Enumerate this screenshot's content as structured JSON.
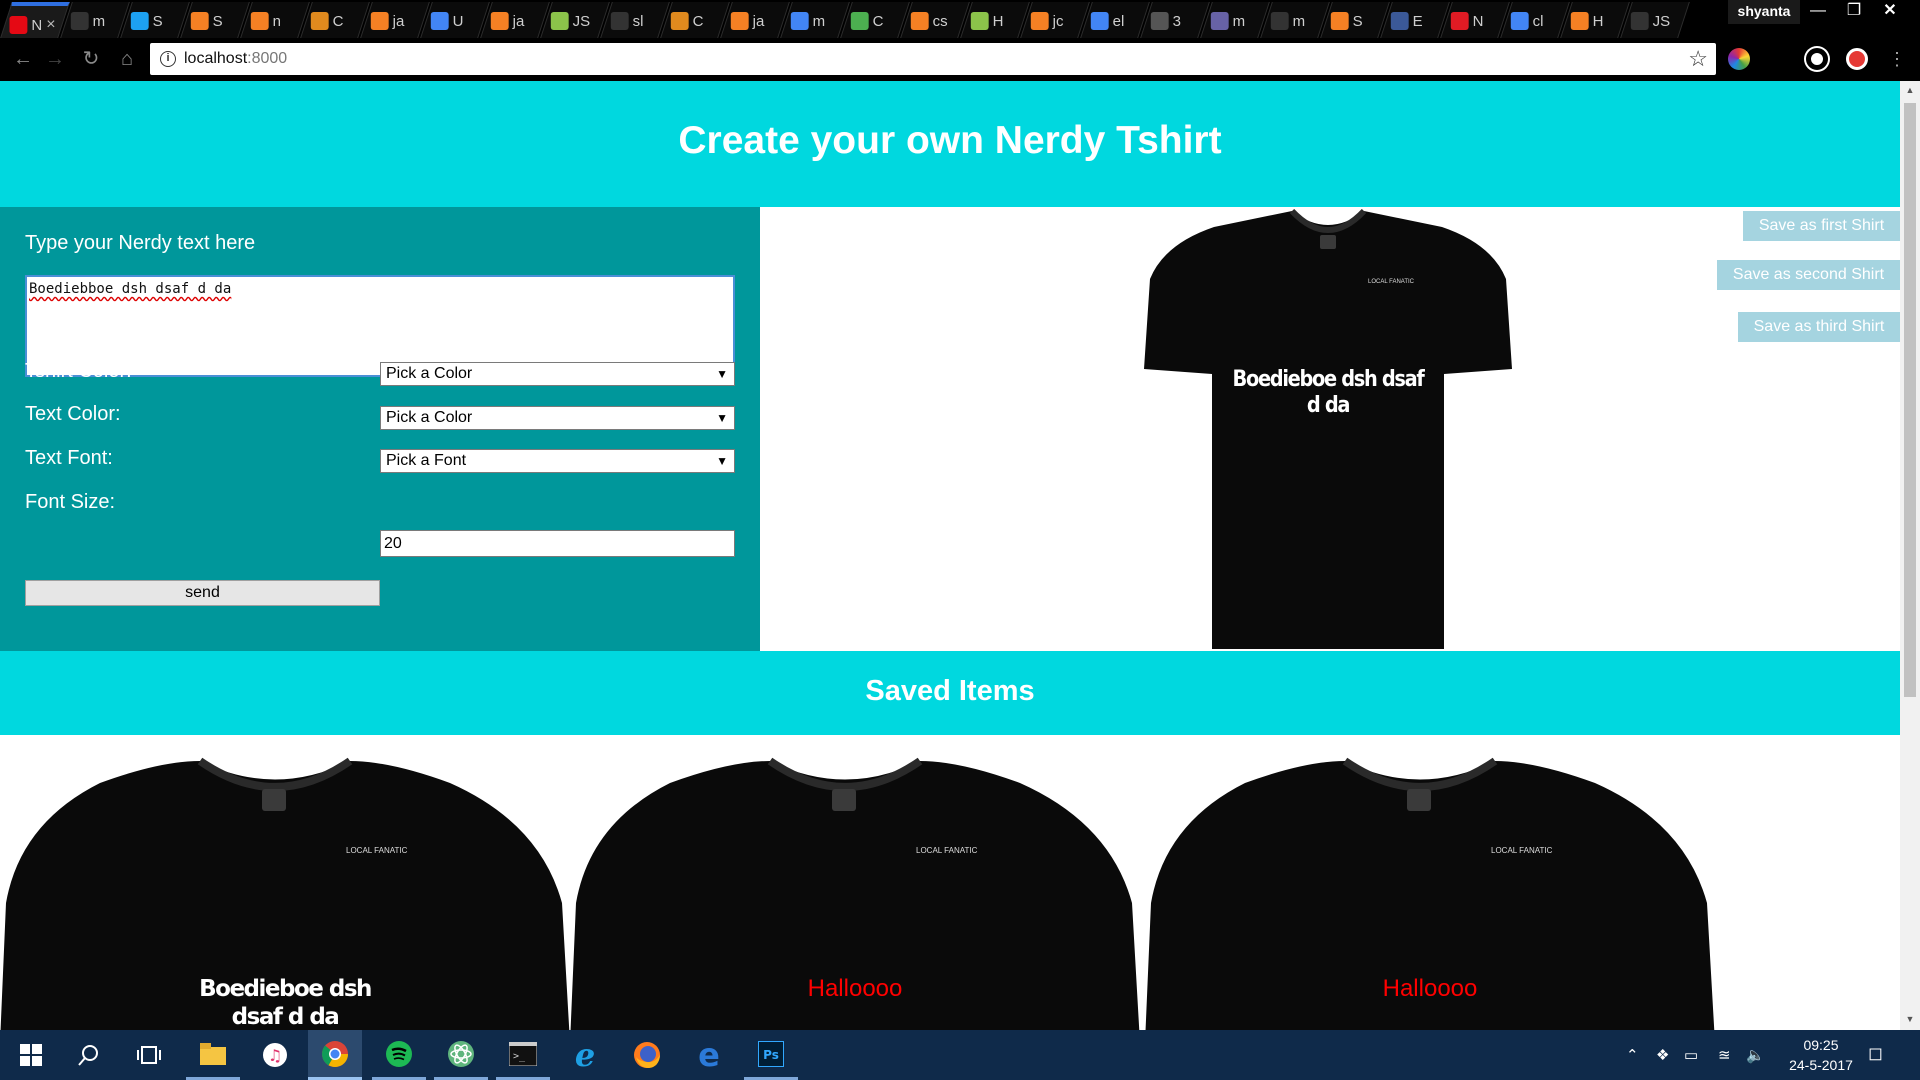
{
  "browser": {
    "tabs": [
      {
        "text": "N",
        "icon": "netflix-icon",
        "color": "#e50914",
        "active": true,
        "close": "×"
      },
      {
        "text": "m",
        "icon": "github-icon",
        "color": "#333333"
      },
      {
        "text": "S",
        "icon": "twitter-icon",
        "color": "#1da1f2"
      },
      {
        "text": "S",
        "icon": "stackoverflow-icon",
        "color": "#f48024"
      },
      {
        "text": "n",
        "icon": "stackoverflow-icon",
        "color": "#f48024"
      },
      {
        "text": "C",
        "icon": "codeschool-icon",
        "color": "#e08a1e"
      },
      {
        "text": "ja",
        "icon": "stackoverflow-icon",
        "color": "#f48024"
      },
      {
        "text": "U",
        "icon": "google-icon",
        "color": "#4285f4"
      },
      {
        "text": "ja",
        "icon": "stackoverflow-icon",
        "color": "#f48024"
      },
      {
        "text": "JS",
        "icon": "jsbin-icon",
        "color": "#8bc34a"
      },
      {
        "text": "sl",
        "icon": "github-icon",
        "color": "#333333"
      },
      {
        "text": "C",
        "icon": "codeschool-icon",
        "color": "#e08a1e"
      },
      {
        "text": "ja",
        "icon": "stackoverflow-icon",
        "color": "#f48024"
      },
      {
        "text": "m",
        "icon": "google-icon",
        "color": "#4285f4"
      },
      {
        "text": "C",
        "icon": "chart-icon",
        "color": "#4caf50"
      },
      {
        "text": "cs",
        "icon": "stackoverflow-icon",
        "color": "#f48024"
      },
      {
        "text": "H",
        "icon": "jsbin-icon",
        "color": "#8bc34a"
      },
      {
        "text": "jc",
        "icon": "stackoverflow-icon",
        "color": "#f48024"
      },
      {
        "text": "el",
        "icon": "google-icon",
        "color": "#4285f4"
      },
      {
        "text": "3",
        "icon": "octocat-icon",
        "color": "#555555"
      },
      {
        "text": "m",
        "icon": "heroku-icon",
        "color": "#6762a6"
      },
      {
        "text": "m",
        "icon": "github-icon",
        "color": "#333333"
      },
      {
        "text": "S",
        "icon": "stackoverflow-icon",
        "color": "#f48024"
      },
      {
        "text": "E",
        "icon": "facebook-icon",
        "color": "#3b5998"
      },
      {
        "text": "N",
        "icon": "opera-icon",
        "color": "#e01b24"
      },
      {
        "text": "cl",
        "icon": "google-icon",
        "color": "#4285f4"
      },
      {
        "text": "H",
        "icon": "stackoverflow-icon",
        "color": "#f48024"
      },
      {
        "text": "JS",
        "icon": "github-icon",
        "color": "#333333"
      }
    ],
    "profile_name": "shyanta",
    "url_host": "localhost",
    "url_port": ":8000"
  },
  "page": {
    "title": "Create your own Nerdy Tshirt",
    "form": {
      "prompt": "Type your Nerdy text here",
      "text_value": "Boediebboe dsh dsaf d da",
      "tshirt_color_label": "Tshirt Color:",
      "tshirt_color_value": "Pick a Color",
      "text_color_label": "Text Color:",
      "text_color_value": "Pick a Color",
      "text_font_label": "Text Font:",
      "text_font_value": "Pick a Font",
      "font_size_label": "Font Size:",
      "font_size_value": "20",
      "send_label": "send"
    },
    "preview": {
      "shirt_text_line1": "Boedieboe dsh dsaf",
      "shirt_text_line2": "d da",
      "brand": "LOCAL FANATIC",
      "shirt_color": "#0a0a0a",
      "text_color": "#ffffff"
    },
    "save_buttons": {
      "first": "Save as first Shirt",
      "second": "Save as second Shirt",
      "third": "Save as third Shirt"
    },
    "saved": {
      "title": "Saved Items",
      "items": [
        {
          "line1": "Boedieboe dsh",
          "line2": "dsaf d da",
          "text_color": "#ffffff"
        },
        {
          "line1": "Halloooo",
          "line2": "",
          "text_color": "#ff0000"
        },
        {
          "line1": "Halloooo",
          "line2": "",
          "text_color": "#ff0000"
        }
      ]
    }
  },
  "taskbar": {
    "apps": [
      "windows-start-icon",
      "search-icon",
      "task-view-icon",
      "file-explorer-icon",
      "itunes-icon",
      "chrome-icon",
      "spotify-icon",
      "atom-icon",
      "terminal-icon",
      "internet-explorer-icon",
      "firefox-icon",
      "edge-icon",
      "photoshop-icon"
    ],
    "time": "09:25",
    "date": "24-5-2017"
  },
  "colors": {
    "accent_cyan": "#00d8df",
    "form_teal": "#00979b",
    "save_button_bg": "#a5d4e0"
  }
}
